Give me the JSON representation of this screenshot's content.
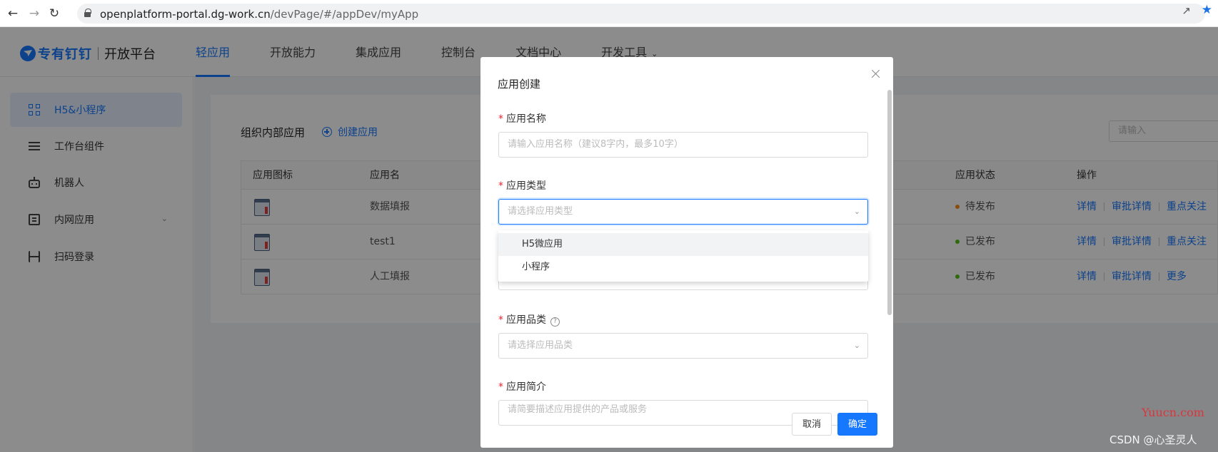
{
  "browser": {
    "url_host": "openplatform-portal.dg-work.cn",
    "url_path": "/devPage/#/appDev/myApp"
  },
  "header": {
    "brand": "专有钉钉",
    "platform": "开放平台",
    "nav": [
      {
        "label": "轻应用",
        "active": true
      },
      {
        "label": "开放能力"
      },
      {
        "label": "集成应用"
      },
      {
        "label": "控制台"
      },
      {
        "label": "文档中心"
      },
      {
        "label": "开发工具"
      }
    ]
  },
  "sidebar": {
    "items": [
      {
        "label": "H5&小程序",
        "icon": "grid-icon",
        "active": true
      },
      {
        "label": "工作台组件",
        "icon": "list-icon"
      },
      {
        "label": "机器人",
        "icon": "robot-icon"
      },
      {
        "label": "内网应用",
        "icon": "document-icon",
        "expandable": true
      },
      {
        "label": "扫码登录",
        "icon": "scan-icon"
      }
    ]
  },
  "main": {
    "section_title": "组织内部应用",
    "create_label": "创建应用",
    "search_placeholder": "请输入",
    "table": {
      "headers": {
        "icon": "应用图标",
        "name": "应用名",
        "status": "应用状态",
        "ops": "操作"
      },
      "rows": [
        {
          "name": "数据填报",
          "status": "待发布",
          "status_color": "#fa8c16",
          "ops": [
            "详情",
            "审批详情",
            "重点关注"
          ]
        },
        {
          "name": "test1",
          "status": "已发布",
          "status_color": "#52c41a",
          "ops": [
            "详情",
            "审批详情",
            "重点关注"
          ]
        },
        {
          "name": "人工填报",
          "status": "已发布",
          "status_color": "#52c41a",
          "ops": [
            "详情",
            "审批详情",
            "更多"
          ]
        }
      ]
    }
  },
  "modal": {
    "title": "应用创建",
    "fields": {
      "name_label": "应用名称",
      "name_placeholder": "请输入应用名称（建议8字内，最多10字）",
      "type_label": "应用类型",
      "type_placeholder": "请选择应用类型",
      "type_options": [
        "H5微应用",
        "小程序"
      ],
      "category_label": "应用品类",
      "category_placeholder": "请选择应用品类",
      "intro_label": "应用简介",
      "intro_placeholder": "请简要描述应用提供的产品或服务"
    },
    "cancel_label": "取消",
    "ok_label": "确定"
  },
  "watermark": {
    "site": "Yuucn.com",
    "author": "CSDN @心圣灵人"
  },
  "colors": {
    "primary": "#1677ff",
    "pending": "#fa8c16",
    "published": "#52c41a",
    "required": "#f5222d"
  }
}
